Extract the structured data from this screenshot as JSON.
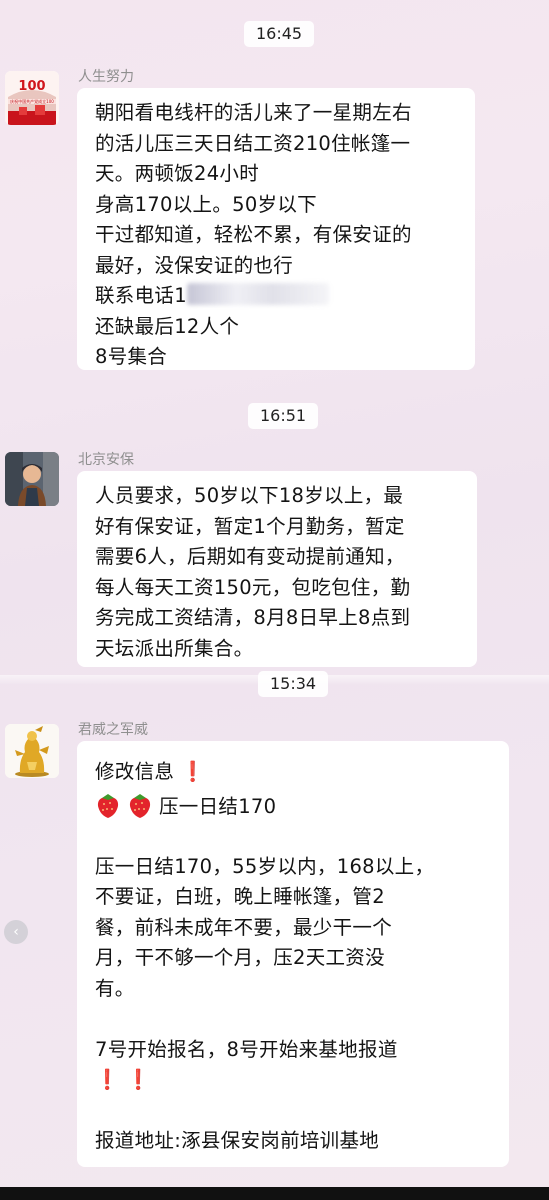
{
  "timestamps": [
    "16:45",
    "16:51",
    "15:34"
  ],
  "messages": [
    {
      "sender": "人生努力",
      "avatar_icon": "party-anniversary-banner-icon",
      "lines": [
        "朝阳看电线杆的活儿来了一星期左右",
        "的活儿压三天日结工资210住帐篷一",
        "天。两顿饭24小时",
        "身高170以上。50岁以下",
        "干过都知道，轻松不累，有保安证的",
        "最好，没保安证的也行",
        "联系电话1",
        "还缺最后12人个",
        "8号集合"
      ]
    },
    {
      "sender": "北京安保",
      "avatar_icon": "boy-portrait-icon",
      "lines": [
        "人员要求，50岁以下18岁以上，最",
        "好有保安证，暂定1个月勤务，暂定",
        "需要6人，后期如有变动提前通知，",
        "每人每天工资150元，包吃包住，勤",
        "务完成工资结清，8月8日早上8点到",
        "天坛派出所集合。"
      ]
    },
    {
      "sender": "君威之军威",
      "avatar_icon": "golden-statue-icon",
      "title": "修改信息",
      "subtitle": "压一日结170",
      "lines": [
        "压一日结170，55岁以内，168以上，",
        "不要证，白班，晚上睡帐篷，管2",
        "餐，前科未成年不要，最少干一个",
        "月，干不够一个月，压2天工资没",
        "有。"
      ],
      "signup": "7号开始报名，8号开始来基地报道",
      "address": "报道地址:涿县保安岗前培训基地"
    }
  ],
  "colors": {
    "background": "#f3e6ef",
    "bubble": "#ffffff",
    "sender_text": "#8f8f8f",
    "exclamation": "#d92022"
  }
}
